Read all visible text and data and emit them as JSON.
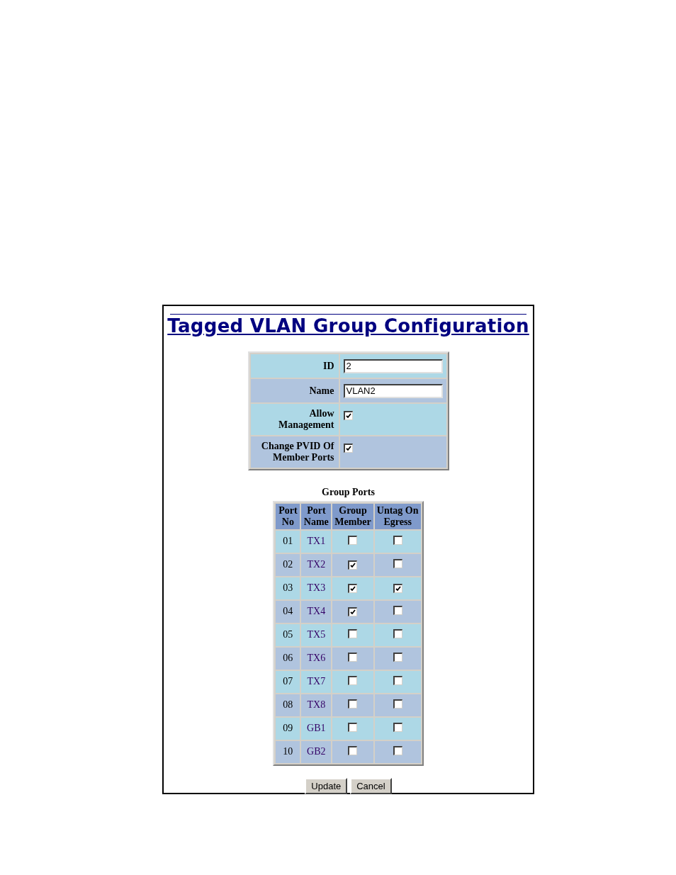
{
  "title": "Tagged VLAN Group Configuration",
  "settings": [
    {
      "kind": "text",
      "label": "ID",
      "value": "2"
    },
    {
      "kind": "text",
      "label": "Name",
      "value": "VLAN2"
    },
    {
      "kind": "checkbox",
      "label": "Allow Management",
      "checked": true
    },
    {
      "kind": "checkbox",
      "label": "Change PVID Of Member Ports",
      "checked": true
    }
  ],
  "group_ports": {
    "caption": "Group Ports",
    "columns": [
      "Port No",
      "Port Name",
      "Group Member",
      "Untag On Egress"
    ],
    "rows": [
      {
        "port_no": "01",
        "port_name": "TX1",
        "group_member": false,
        "untag_on_egress": false
      },
      {
        "port_no": "02",
        "port_name": "TX2",
        "group_member": true,
        "untag_on_egress": false
      },
      {
        "port_no": "03",
        "port_name": "TX3",
        "group_member": true,
        "untag_on_egress": true
      },
      {
        "port_no": "04",
        "port_name": "TX4",
        "group_member": true,
        "untag_on_egress": false
      },
      {
        "port_no": "05",
        "port_name": "TX5",
        "group_member": false,
        "untag_on_egress": false
      },
      {
        "port_no": "06",
        "port_name": "TX6",
        "group_member": false,
        "untag_on_egress": false
      },
      {
        "port_no": "07",
        "port_name": "TX7",
        "group_member": false,
        "untag_on_egress": false
      },
      {
        "port_no": "08",
        "port_name": "TX8",
        "group_member": false,
        "untag_on_egress": false
      },
      {
        "port_no": "09",
        "port_name": "GB1",
        "group_member": false,
        "untag_on_egress": false
      },
      {
        "port_no": "10",
        "port_name": "GB2",
        "group_member": false,
        "untag_on_egress": false
      }
    ]
  },
  "buttons": [
    "Update",
    "Cancel"
  ]
}
